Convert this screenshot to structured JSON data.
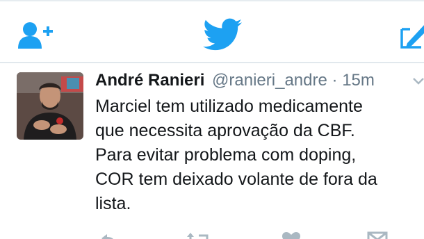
{
  "nav": {
    "icons": [
      "follow-icon",
      "twitter-bird-icon",
      "compose-icon"
    ],
    "accent_color": "#1da1f2"
  },
  "tweet": {
    "author_name": "André Ranieri",
    "handle": "@ranieri_andre",
    "separator": "·",
    "time": "15m",
    "lines": [
      "Marciel tem utilizado medicamente",
      "que necessita aprovação da CBF.",
      "Para evitar problema com doping,",
      "COR tem deixado volante de fora da",
      "lista."
    ]
  },
  "actions": {
    "icons": [
      "reply-icon",
      "retweet-icon",
      "like-icon",
      "direct-message-icon"
    ],
    "muted_color": "#aab8c2"
  }
}
